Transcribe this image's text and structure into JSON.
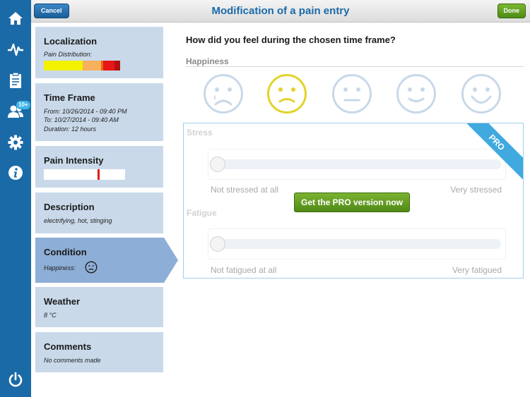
{
  "topbar": {
    "cancel_label": "Cancel",
    "title": "Modification of a pain entry",
    "done_label": "Done"
  },
  "nav": {
    "badge": "10+",
    "items": [
      "home-icon",
      "activity-icon",
      "clipboard-icon",
      "users-icon",
      "gear-icon",
      "info-icon",
      "power-icon"
    ]
  },
  "sections": {
    "localization": {
      "title": "Localization",
      "subtitle": "Pain Distribution:"
    },
    "time_frame": {
      "title": "Time Frame",
      "from": "From: 10/26/2014 - 09:40 PM",
      "to": "To: 10/27/2014 - 09:40 AM",
      "duration": "Duration: 12 hours"
    },
    "pain_intensity": {
      "title": "Pain Intensity",
      "value_fraction": 0.68
    },
    "description": {
      "title": "Description",
      "subtitle": "electrifying, hot, stinging"
    },
    "condition": {
      "title": "Condition",
      "subtitle": "Happiness:"
    },
    "weather": {
      "title": "Weather",
      "subtitle": "8 °C"
    },
    "comments": {
      "title": "Comments",
      "subtitle": "No comments made"
    }
  },
  "main": {
    "question": "How did you feel during the chosen time frame?",
    "happiness_label": "Happiness",
    "selected_face": 1,
    "stress": {
      "label": "Stress",
      "min_label": "Not stressed at all",
      "max_label": "Very stressed",
      "value": 0
    },
    "fatigue": {
      "label": "Fatigue",
      "min_label": "Not fatigued at all",
      "max_label": "Very fatigued",
      "value": 0
    },
    "pro_button": "Get the PRO version now",
    "pro_ribbon": "PRO"
  },
  "colors": {
    "nav": "#1b6aa8",
    "card": "#c9d9ea",
    "card_active": "#8daed6",
    "face_selected": "#e3d22a",
    "face_default": "#c9d8e8",
    "pro_green": "#5f9c20",
    "ribbon": "#3fa9e0"
  }
}
